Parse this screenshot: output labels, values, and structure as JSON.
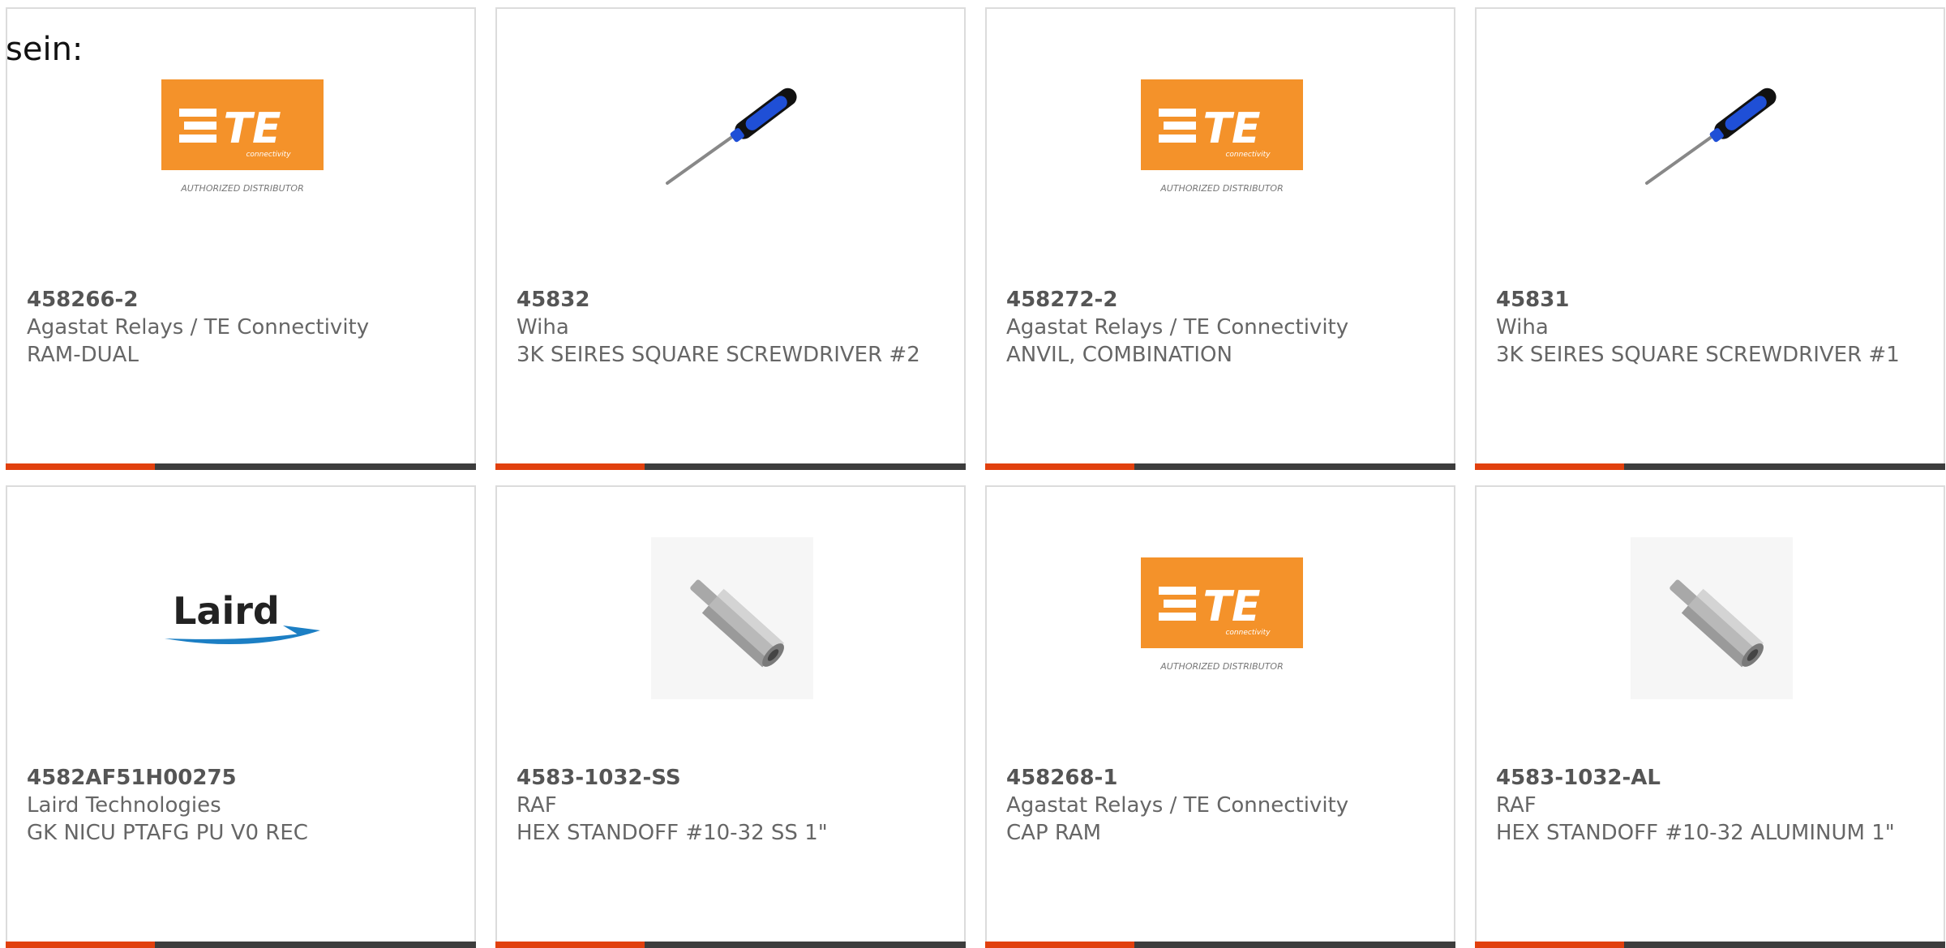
{
  "intro_text": "sein:",
  "colors": {
    "accent_bar": "#e1400e",
    "dark_bar": "#3d3d3d",
    "te_orange": "#f4922a",
    "laird_blue": "#1c7fc4",
    "screwdriver_blue": "#1f4fd6"
  },
  "products": [
    {
      "part_number": "458266-2",
      "manufacturer": "Agastat Relays / TE Connectivity",
      "description": "RAM-DUAL",
      "image": "te-connectivity-logo",
      "logo_caption": "AUTHORIZED DISTRIBUTOR",
      "logo_text": "TE",
      "logo_subtext": "connectivity"
    },
    {
      "part_number": "45832",
      "manufacturer": "Wiha",
      "description": "3K SEIRES SQUARE SCREWDRIVER #2",
      "image": "screwdriver-image"
    },
    {
      "part_number": "458272-2",
      "manufacturer": "Agastat Relays / TE Connectivity",
      "description": "ANVIL, COMBINATION",
      "image": "te-connectivity-logo",
      "logo_caption": "AUTHORIZED DISTRIBUTOR",
      "logo_text": "TE",
      "logo_subtext": "connectivity"
    },
    {
      "part_number": "45831",
      "manufacturer": "Wiha",
      "description": "3K SEIRES SQUARE SCREWDRIVER #1",
      "image": "screwdriver-image"
    },
    {
      "part_number": "4582AF51H00275",
      "manufacturer": "Laird Technologies",
      "description": "GK NICU PTAFG PU V0 REC",
      "image": "laird-logo",
      "logo_text": "Laird"
    },
    {
      "part_number": "4583-1032-SS",
      "manufacturer": "RAF",
      "description": "HEX STANDOFF #10-32 SS 1\"",
      "image": "hex-standoff-image"
    },
    {
      "part_number": "458268-1",
      "manufacturer": "Agastat Relays / TE Connectivity",
      "description": "CAP RAM",
      "image": "te-connectivity-logo",
      "logo_caption": "AUTHORIZED DISTRIBUTOR",
      "logo_text": "TE",
      "logo_subtext": "connectivity"
    },
    {
      "part_number": "4583-1032-AL",
      "manufacturer": "RAF",
      "description": "HEX STANDOFF #10-32 ALUMINUM 1\"",
      "image": "hex-standoff-image"
    }
  ]
}
